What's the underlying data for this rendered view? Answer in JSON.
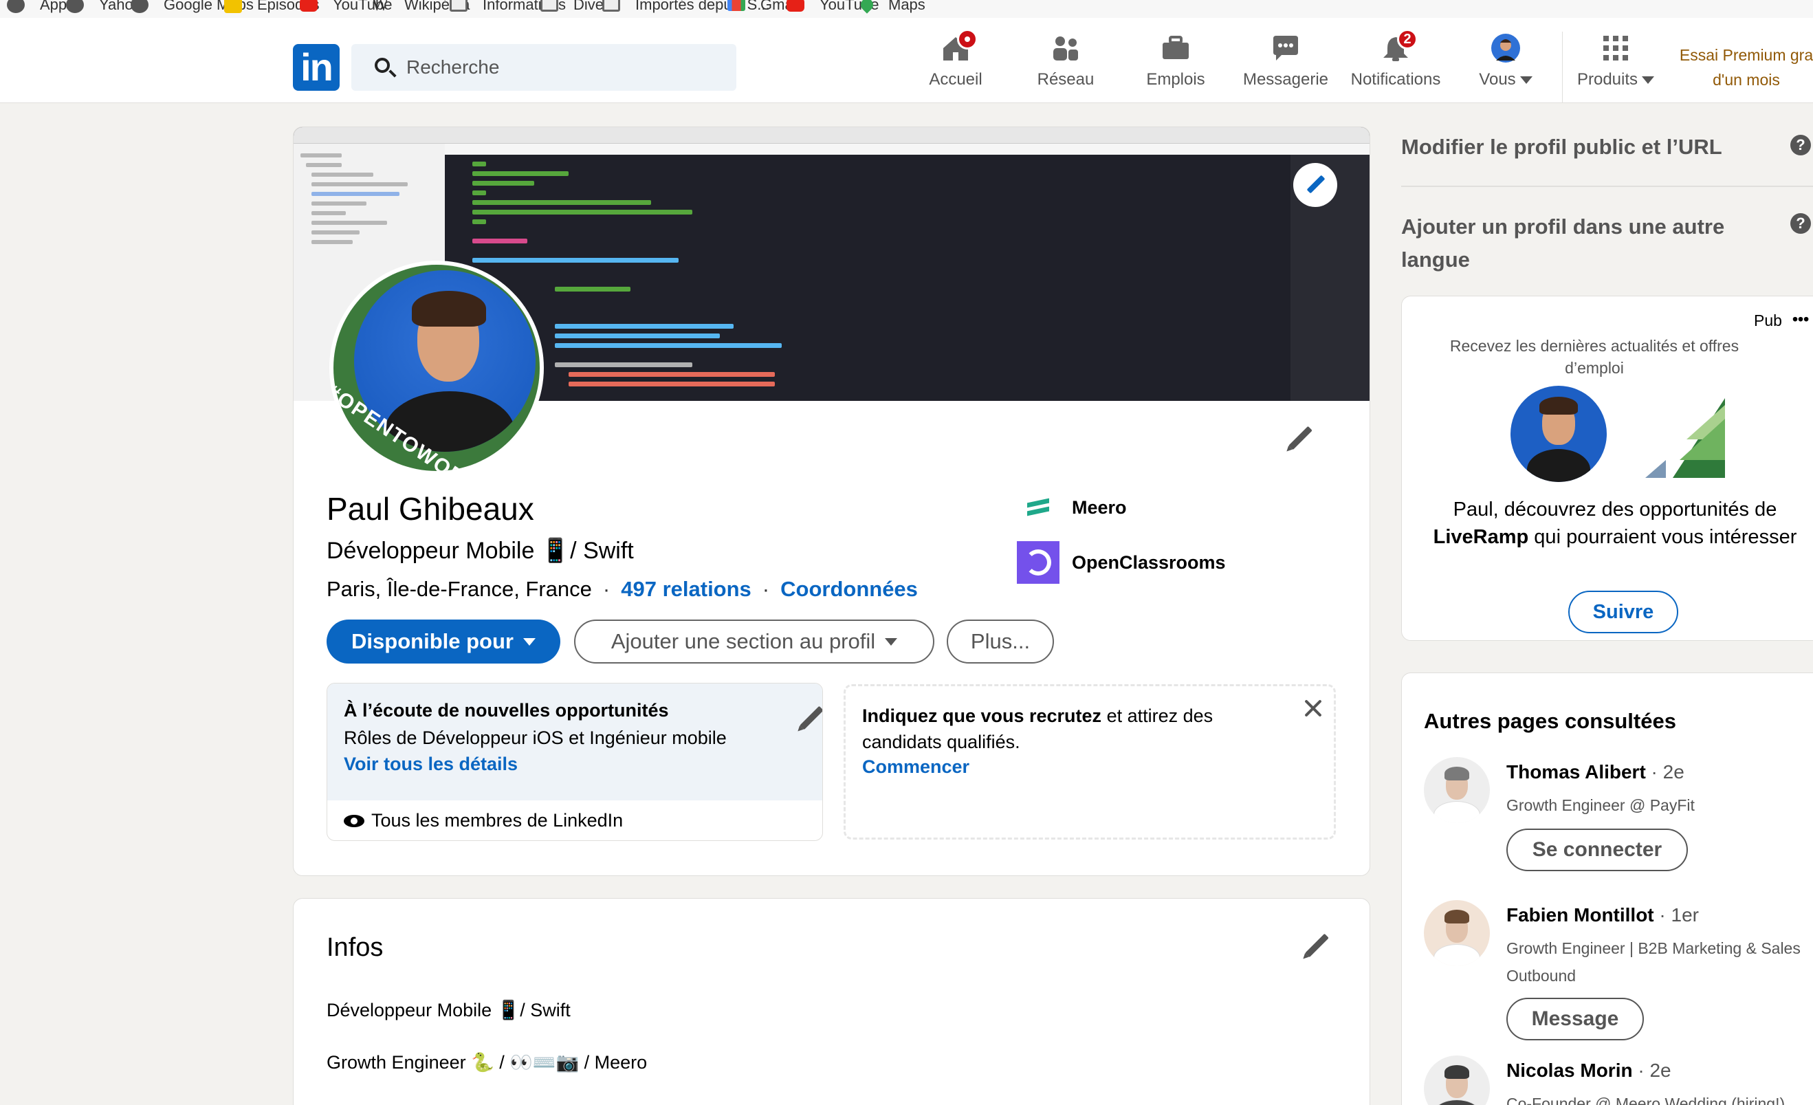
{
  "bookmarks": [
    "Apple",
    "Yahoo!",
    "Google Maps",
    "Episodes",
    "YouTube",
    "Wikipédia",
    "Informations",
    "Divers",
    "Importés depuis S...",
    "Gmail",
    "YouTube",
    "Maps"
  ],
  "navbar": {
    "logo": "in",
    "search_placeholder": "Recherche",
    "items": [
      {
        "label": "Accueil",
        "icon": "home-icon"
      },
      {
        "label": "Réseau",
        "icon": "network-icon"
      },
      {
        "label": "Emplois",
        "icon": "briefcase-icon"
      },
      {
        "label": "Messagerie",
        "icon": "chat-icon"
      },
      {
        "label": "Notifications",
        "icon": "bell-icon",
        "badge": "2"
      },
      {
        "label": "Vous",
        "icon": "avatar"
      },
      {
        "label": "Produits",
        "icon": "grid-icon"
      }
    ],
    "premium": "Essai Premium gra d'un mois"
  },
  "profile": {
    "avatar_frame_text": "#OPENTOWORK",
    "name": "Paul Ghibeaux",
    "headline": "Développeur Mobile 📱/ Swift",
    "location": "Paris, Île-de-France, France",
    "separator": "·",
    "connections": "497 relations",
    "contact": "Coordonnées",
    "companies": [
      {
        "name": "Meero"
      },
      {
        "name": "OpenClassrooms"
      }
    ],
    "buttons": {
      "open_to": "Disponible pour",
      "add_section": "Ajouter une section au profil",
      "more": "Plus..."
    },
    "open_to_work": {
      "title": "À l’écoute de nouvelles opportunités",
      "roles": "Rôles de Développeur iOS et Ingénieur mobile",
      "details_link": "Voir tous les détails",
      "visibility": "Tous les membres de LinkedIn"
    },
    "hiring": {
      "bold": "Indiquez que vous recrutez",
      "rest": " et attirez des candidats qualifiés.",
      "link": "Commencer"
    }
  },
  "infos": {
    "title": "Infos",
    "line1": "Développeur Mobile 📱/ Swift",
    "line2": "Growth Engineer 🐍 / 👀⌨️📷 / Meero"
  },
  "rail": {
    "public_profile": "Modifier le profil public et l’URL",
    "other_language": "Ajouter un profil dans une autre langue",
    "help": "?",
    "ad": {
      "pub": "Pub",
      "dots": "•••",
      "subtitle": "Recevez les dernières actualités et offres d’emploi",
      "text_before": "Paul, découvrez des opportunités de ",
      "company": "LiveRamp",
      "text_after": " qui pourraient vous intéresser",
      "follow": "Suivre"
    },
    "pages": {
      "title": "Autres pages consultées",
      "people": [
        {
          "name": "Thomas Alibert",
          "degree": " · 2e",
          "desc": "Growth Engineer @ PayFit",
          "button": "Se connecter"
        },
        {
          "name": "Fabien Montillot",
          "degree": " · 1er",
          "desc": "Growth Engineer | B2B Marketing & Sales Outbound",
          "button": "Message"
        },
        {
          "name": "Nicolas Morin",
          "degree": " · 2e",
          "desc": "Co-Founder @ Meero Wedding (hiring!)"
        }
      ]
    }
  },
  "colors": {
    "linkedin_blue": "#0a66c2",
    "badge_red": "#cc1016",
    "premium_gold": "#915907",
    "page_bg": "#f3f2ef"
  }
}
